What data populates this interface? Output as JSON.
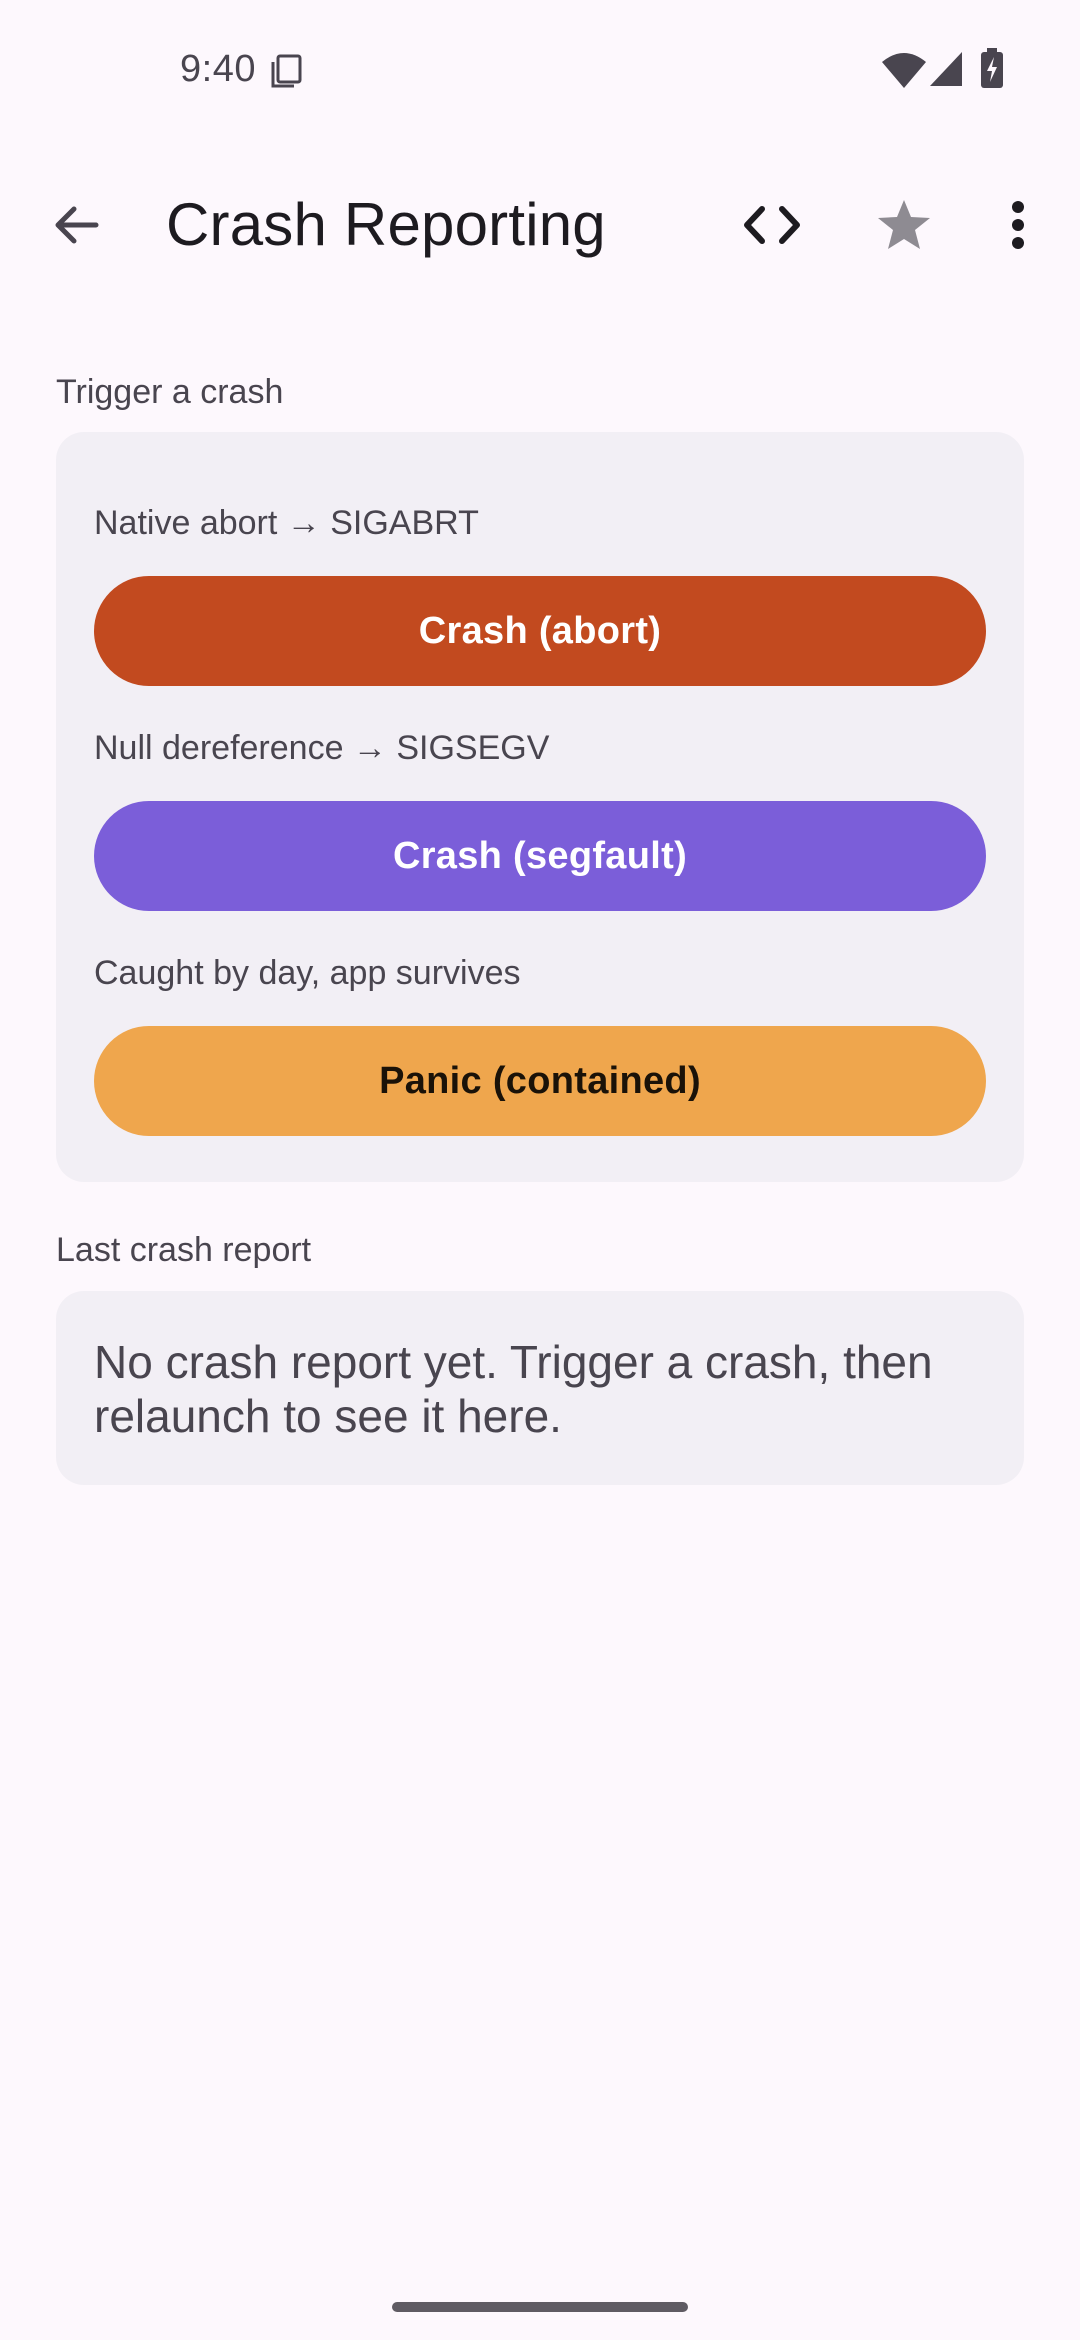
{
  "status_bar": {
    "time": "9:40"
  },
  "app_bar": {
    "title": "Crash Reporting",
    "icons": [
      "back-arrow-icon",
      "code-icon",
      "star-icon",
      "more-vert-icon"
    ]
  },
  "trigger_section": {
    "label": "Trigger a crash",
    "rows": [
      {
        "caption": "Native abort → SIGABRT",
        "button": "Crash (abort)",
        "color": "#c24a1f"
      },
      {
        "caption": "Null dereference → SIGSEGV",
        "button": "Crash (segfault)",
        "color": "#7b5ed9"
      },
      {
        "caption": "Caught by day, app survives",
        "button": "Panic (contained)",
        "color": "#efa64d"
      }
    ]
  },
  "report_section": {
    "label": "Last crash report",
    "text": "No crash report yet. Trigger a crash, then relaunch to see it here."
  },
  "colors": {
    "background": "#fdf8fd",
    "card": "#f2eff5",
    "text_secondary": "#49454f"
  }
}
